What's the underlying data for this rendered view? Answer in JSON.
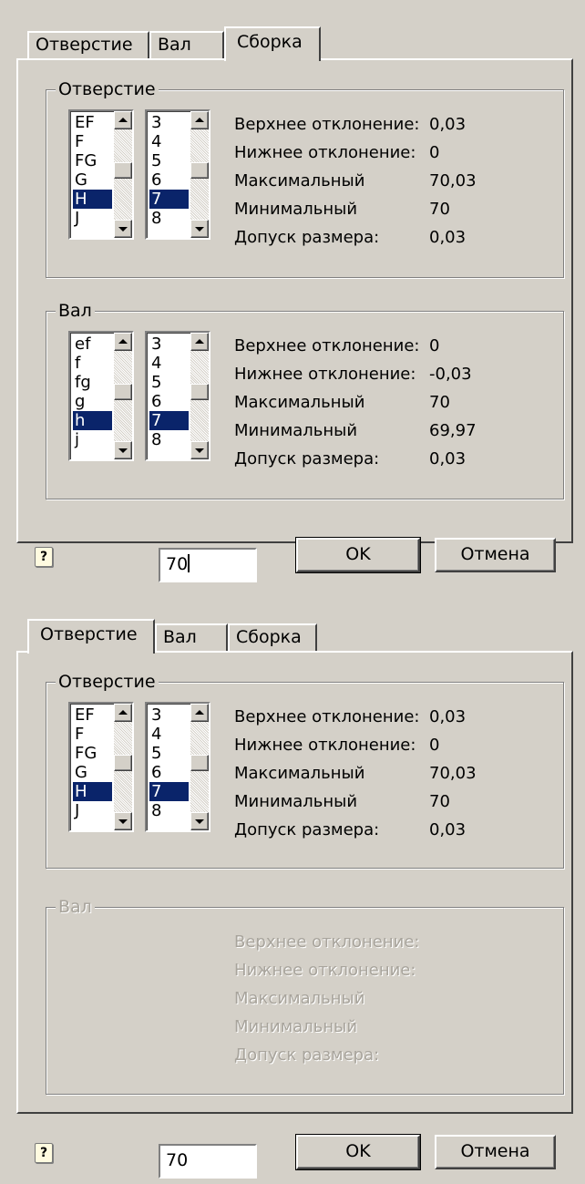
{
  "tabs": [
    "Отверстие",
    "Вал",
    "Сборка"
  ],
  "hole_group": {
    "title": "Отверстие",
    "letters": [
      "EF",
      "F",
      "FG",
      "G",
      "H",
      "J"
    ],
    "selected_letter": "H",
    "grades": [
      "3",
      "4",
      "5",
      "6",
      "7",
      "8"
    ],
    "selected_grade": "7",
    "rows": [
      {
        "label": "Верхнее отклонение:",
        "value": "0,03"
      },
      {
        "label": "Нижнее отклонение:",
        "value": "0"
      },
      {
        "label": "Максимальный",
        "value": "70,03"
      },
      {
        "label": "Минимальный",
        "value": "70"
      },
      {
        "label": "Допуск размера:",
        "value": "0,03"
      }
    ]
  },
  "shaft_group": {
    "title": "Вал",
    "letters": [
      "ef",
      "f",
      "fg",
      "g",
      "h",
      "j"
    ],
    "selected_letter": "h",
    "grades": [
      "3",
      "4",
      "5",
      "6",
      "7",
      "8"
    ],
    "selected_grade": "7",
    "rows": [
      {
        "label": "Верхнее отклонение:",
        "value": "0"
      },
      {
        "label": "Нижнее отклонение:",
        "value": "-0,03"
      },
      {
        "label": "Максимальный",
        "value": "70"
      },
      {
        "label": "Минимальный",
        "value": "69,97"
      },
      {
        "label": "Допуск размера:",
        "value": "0,03"
      }
    ]
  },
  "shaft_disabled_labels": [
    "Верхнее отклонение:",
    "Нижнее отклонение:",
    "Максимальный",
    "Минимальный",
    "Допуск размера:"
  ],
  "bottom": {
    "size_value": "70",
    "ok_label": "OK",
    "cancel_label": "Отмена",
    "help_icon": "?"
  },
  "colors": {
    "face": "#d4d0c8",
    "selection": "#0a246a",
    "disabled_text": "#a8a49c"
  }
}
